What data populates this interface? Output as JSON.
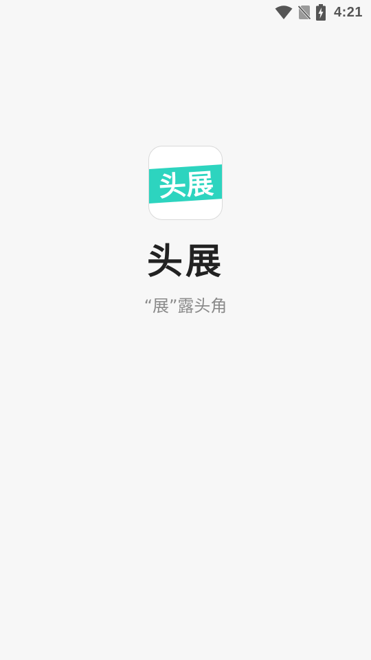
{
  "status_bar": {
    "time": "4:21",
    "icons": [
      "wifi-icon",
      "no-sim-icon",
      "battery-charging-icon"
    ]
  },
  "splash": {
    "app_icon": {
      "name": "app-logo-icon",
      "text": "头展",
      "accent_color": "#2dd4bf"
    },
    "app_name": "头展",
    "slogan": "“展”露头角"
  },
  "colors": {
    "background": "#f7f7f7",
    "accent": "#2dd4bf",
    "title": "#222222",
    "slogan": "#8a8a8a",
    "status_icons": "#555555"
  }
}
